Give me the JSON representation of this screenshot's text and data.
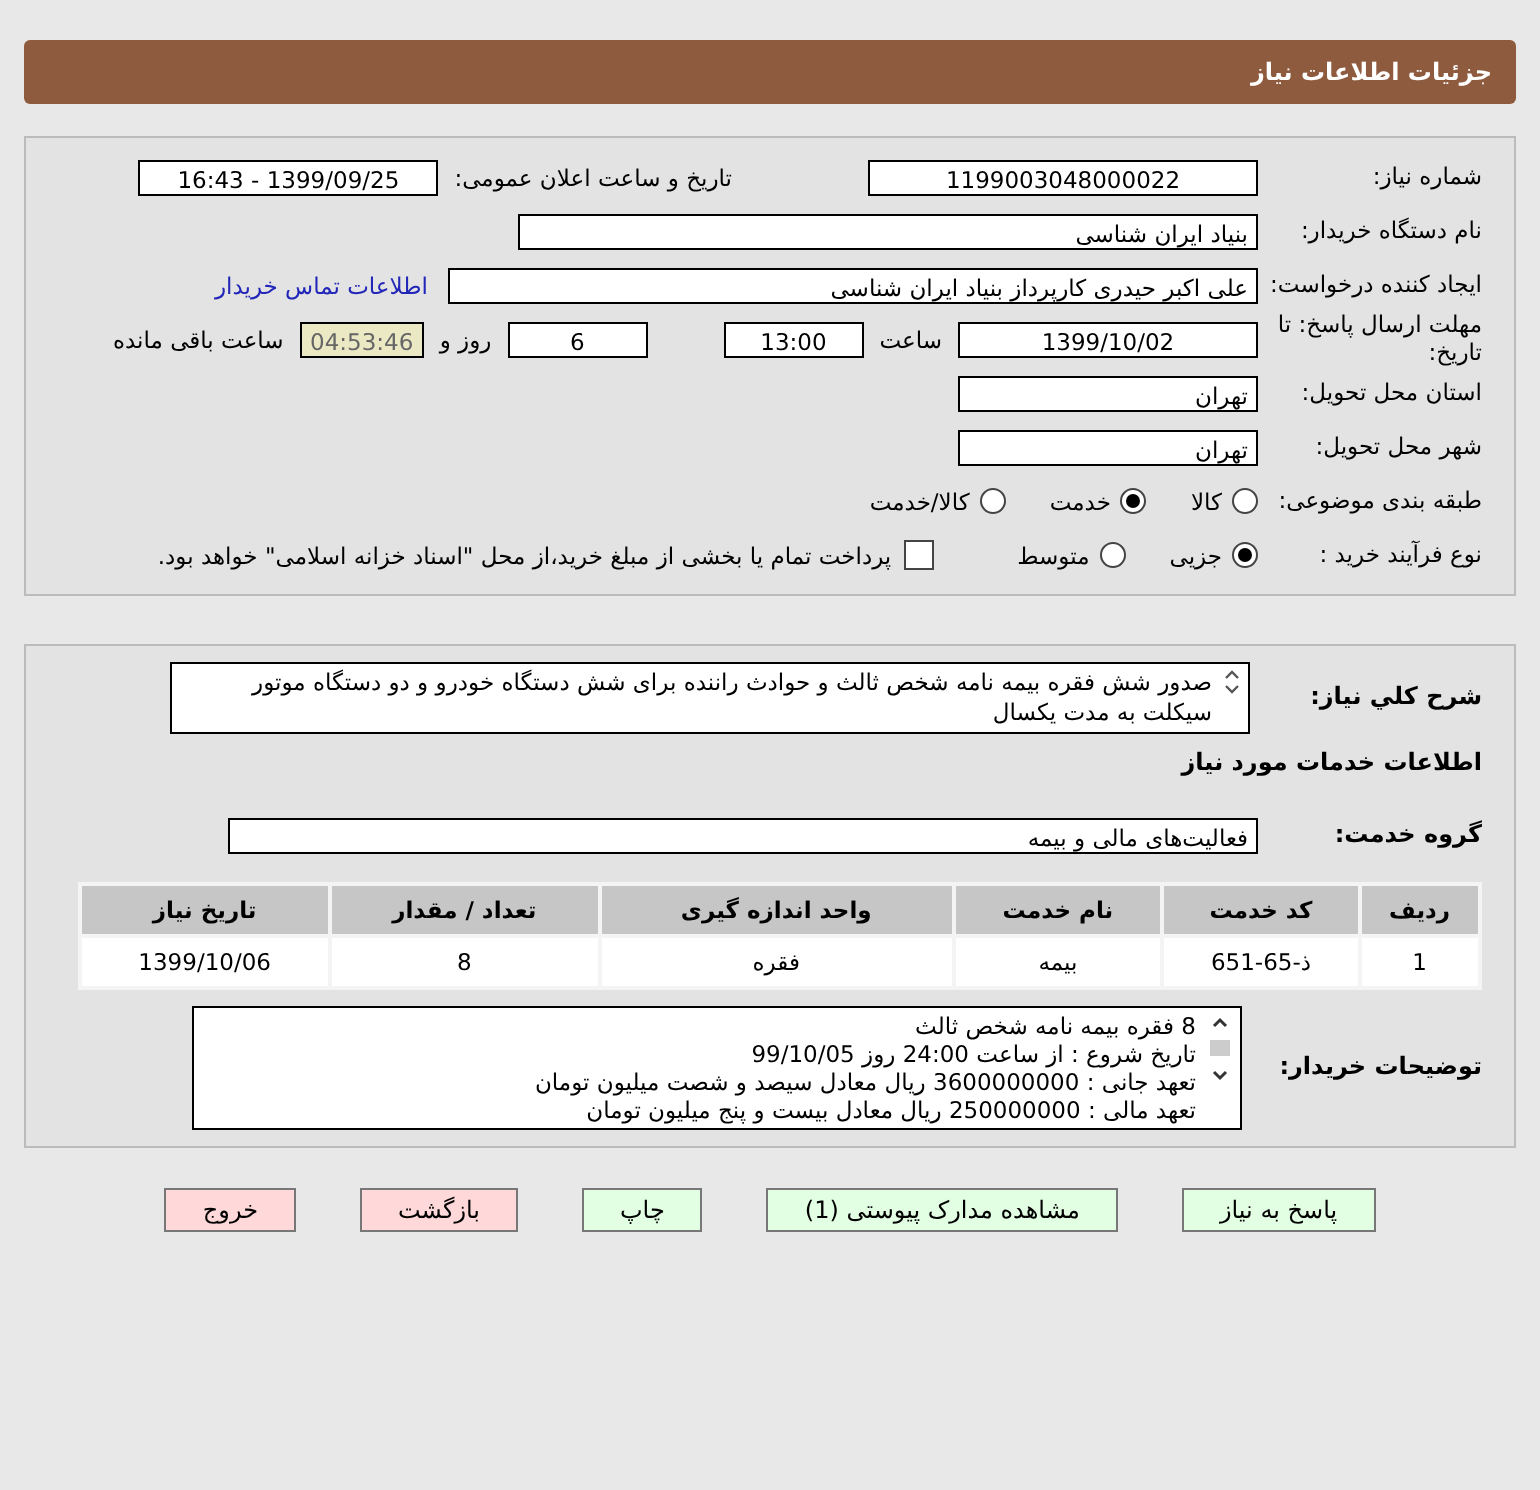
{
  "header": {
    "title": "جزئیات اطلاعات نیاز"
  },
  "need_number": {
    "label": "شماره نیاز:",
    "value": "1199003048000022"
  },
  "announce": {
    "label": "تاریخ و ساعت اعلان عمومی:",
    "value": "1399/09/25 - 16:43"
  },
  "buyer_org": {
    "label": "نام دستگاه خریدار:",
    "value": "بنیاد ایران شناسی"
  },
  "requester": {
    "label": "ایجاد کننده درخواست:",
    "value": "علی اکبر حیدری کارپرداز بنیاد ایران شناسی",
    "link": "اطلاعات تماس خریدار"
  },
  "deadline": {
    "label": "مهلت ارسال پاسخ: تا تاریخ:",
    "date": "1399/10/02",
    "time_label": "ساعت",
    "time": "13:00",
    "days": "6",
    "days_label": "روز و",
    "remaining": "04:53:46",
    "remaining_label": "ساعت باقی مانده"
  },
  "province": {
    "label": "استان محل تحویل:",
    "value": "تهران"
  },
  "city": {
    "label": "شهر محل تحویل:",
    "value": "تهران"
  },
  "category": {
    "label": "طبقه بندی موضوعی:",
    "options": [
      {
        "label": "کالا",
        "selected": false
      },
      {
        "label": "خدمت",
        "selected": true
      },
      {
        "label": "کالا/خدمت",
        "selected": false
      }
    ]
  },
  "process": {
    "label": "نوع فرآیند خرید :",
    "options": [
      {
        "label": "جزیی",
        "selected": true
      },
      {
        "label": "متوسط",
        "selected": false
      }
    ],
    "payment": {
      "checked": false,
      "label": "پرداخت تمام یا بخشی از مبلغ خرید،از محل \"اسناد خزانه اسلامی\" خواهد بود."
    }
  },
  "summary": {
    "label": "شرح کلي نياز:",
    "value": "صدور شش فقره بیمه نامه شخص ثالث و حوادث راننده برای شش دستگاه خودرو و دو دستگاه موتور سیکلت به مدت یکسال"
  },
  "services_title": "اطلاعات خدمات مورد نیاز",
  "service_group": {
    "label": "گروه خدمت:",
    "value": "فعالیت‌های مالی و بیمه"
  },
  "table": {
    "columns": [
      "ردیف",
      "کد خدمت",
      "نام خدمت",
      "واحد اندازه گیری",
      "تعداد / مقدار",
      "تاریخ نیاز"
    ],
    "rows": [
      [
        "1",
        "ذ-65-651",
        "بیمه",
        "فقره",
        "8",
        "1399/10/06"
      ]
    ]
  },
  "buyer_notes": {
    "label": "توضیحات خریدار:",
    "lines": [
      "8 فقره بیمه نامه شخص ثالث",
      "تاریخ شروع : از ساعت 24:00 روز 99/10/05",
      "تعهد جانی : 3600000000 ریال معادل سیصد و شصت میلیون تومان",
      "تعهد مالی : 250000000 ریال معادل بیست و پنج میلیون تومان"
    ]
  },
  "buttons": [
    {
      "label": "پاسخ به نیاز",
      "kind": "normal"
    },
    {
      "label": "مشاهده مدارک پیوستی (1)",
      "kind": "normal"
    },
    {
      "label": "چاپ",
      "kind": "normal"
    },
    {
      "label": "بازگشت",
      "kind": "danger"
    },
    {
      "label": "خروج",
      "kind": "danger"
    }
  ]
}
